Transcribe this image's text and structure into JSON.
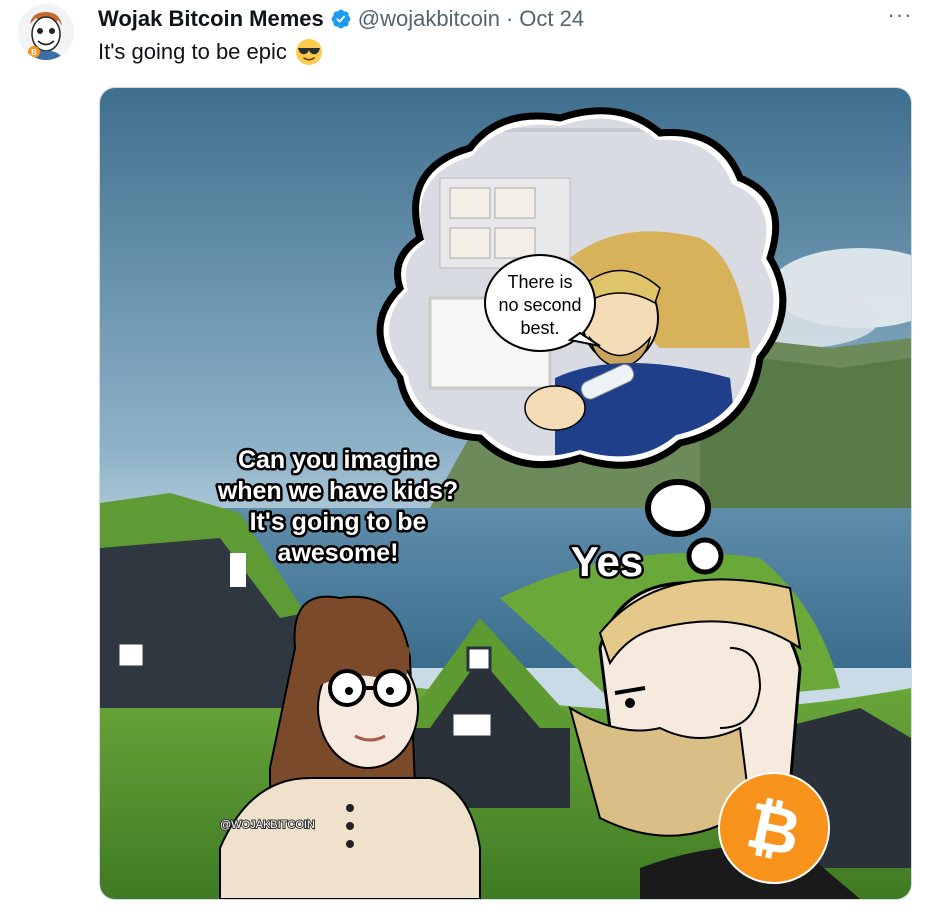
{
  "author": {
    "name": "Wojak Bitcoin Memes",
    "handle": "@wojakbitcoin",
    "separator": "·",
    "date": "Oct 24",
    "avatar_icon": "wojak-avatar-icon"
  },
  "tweet": {
    "text": "It's going to be epic",
    "emoji": "sunglasses-emoji"
  },
  "menu": {
    "label": "···"
  },
  "meme": {
    "speech_girl": [
      "Can you imagine",
      "when we have kids?",
      "It's going to be",
      "awesome!"
    ],
    "speech_guy": "Yes",
    "thought_bubble": [
      "There is",
      "no second",
      "best."
    ],
    "watermark": "@WOJAKBITCOIN",
    "bitcoin_symbol": "₿"
  },
  "colors": {
    "verified": "#1d9bf0",
    "bitcoin": "#f7931a",
    "secondary_text": "#536471"
  }
}
